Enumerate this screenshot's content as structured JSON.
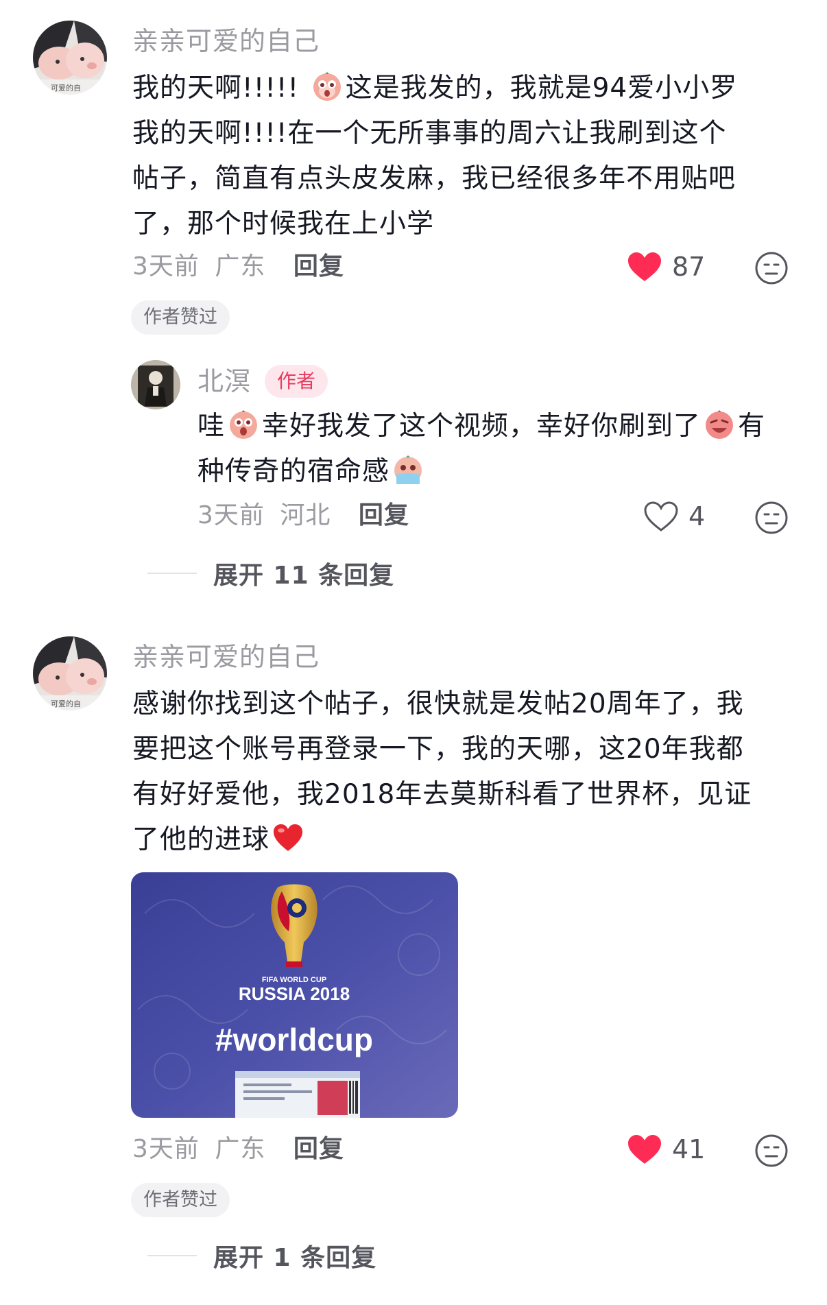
{
  "comments": [
    {
      "username": "亲亲可爱的自己",
      "avatar_caption": "可爱的自",
      "text_a": "我的天啊!!!!!",
      "text_b": "这是我发的，我就是94爱小小罗",
      "text_c": "我的天啊!!!!在一个无所事事的周六让我刷到这个",
      "text_d": "帖子，简直有点头皮发麻，我已经很多年不用贴吧",
      "text_e": "了，那个时候我在上小学",
      "time": "3天前",
      "location": "广东",
      "reply_label": "回复",
      "likes": "87",
      "liked_state": "liked",
      "author_liked_label": "作者赞过"
    },
    {
      "username": "北溟",
      "author_badge": "作者",
      "text_a": "哇",
      "text_b": "幸好我发了这个视频，幸好你刷到了",
      "text_c": "有",
      "text_d": "种传奇的宿命感",
      "time": "3天前",
      "location": "河北",
      "reply_label": "回复",
      "likes": "4",
      "liked_state": "not-liked"
    },
    {
      "username": "亲亲可爱的自己",
      "avatar_caption": "可爱的自",
      "text_a": "感谢你找到这个帖子，很快就是发帖20周年了，我",
      "text_b": "要把这个账号再登录一下，我的天哪，这20年我都",
      "text_c": "有好好爱他，我2018年去莫斯科看了世界杯，见证",
      "text_d": "了他的进球",
      "image": {
        "line1": "FIFA WORLD CUP",
        "line2": "RUSSIA 2018",
        "line3": "#worldcup"
      },
      "time": "3天前",
      "location": "广东",
      "reply_label": "回复",
      "likes": "41",
      "liked_state": "liked",
      "author_liked_label": "作者赞过"
    }
  ],
  "expand_1": "展开 11 条回复",
  "expand_2": "展开 1 条回复",
  "colors": {
    "like_red": "#fe2c55",
    "muted": "#9a9aa0",
    "text": "#161823"
  }
}
